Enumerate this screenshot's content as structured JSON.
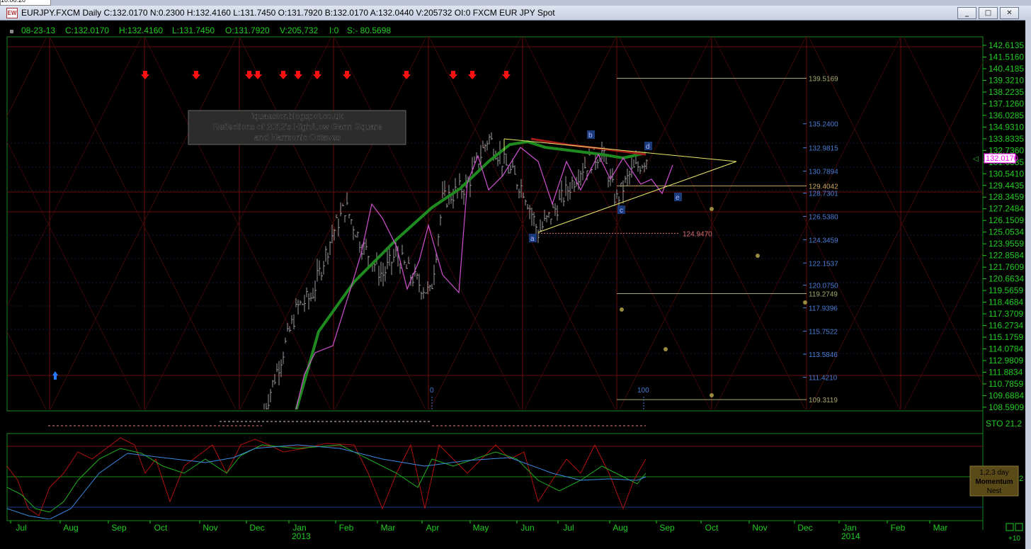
{
  "window": {
    "title": "EURJPY.FXCM Daily C:132.0170 N:0.2300 H:132.4160 L:131.7450 O:131.7920 B:132.0170 A:132.0440 V:205732 OI:0 FXCM EUR JPY Spot",
    "clock": "10:00:20",
    "icon_label": "EW",
    "buttons": {
      "minimize": "_",
      "maximize": "□",
      "close": "✕"
    }
  },
  "info_bar": {
    "date": "08-23-13",
    "close": "C:132.0170",
    "high": "H:132.4160",
    "low": "L:131.7450",
    "open": "O:131.7920",
    "volume": "V:205,732",
    "oi": "I:0",
    "s": "S:- 80.5698"
  },
  "annotation": {
    "line1": "iquaestor.blogspot.co.uk",
    "line2": "Reflections of 2012's High/Low Gann Square",
    "line3": "and Harmonic Octaves"
  },
  "price_axis": {
    "ticks": [
      "142.6135",
      "141.5160",
      "140.4185",
      "139.3210",
      "138.2235",
      "137.1260",
      "136.0285",
      "134.9310",
      "133.8335",
      "132.7360",
      "131.6385",
      "130.5410",
      "129.4435",
      "128.3459",
      "127.2484",
      "126.1509",
      "125.0534",
      "123.9559",
      "122.8584",
      "121.7609",
      "120.6634",
      "119.5659",
      "118.4684",
      "117.3709",
      "116.2734",
      "115.1759",
      "114.0784",
      "112.9809",
      "111.8834",
      "110.7859",
      "109.6884",
      "108.5909"
    ],
    "current": "132.0170"
  },
  "level_labels": [
    {
      "text": "139.5169",
      "price": 139.5169,
      "color": "#a8a870"
    },
    {
      "text": "135.2400",
      "price": 135.24,
      "color": "#4a7cd6"
    },
    {
      "text": "132.9815",
      "price": 132.9815,
      "color": "#4a7cd6"
    },
    {
      "text": "130.7894",
      "price": 130.7894,
      "color": "#4a7cd6"
    },
    {
      "text": "129.4042",
      "price": 129.4042,
      "color": "#c8a860"
    },
    {
      "text": "128.7301",
      "price": 128.7301,
      "color": "#4a7cd6"
    },
    {
      "text": "126.5380",
      "price": 126.538,
      "color": "#4a7cd6"
    },
    {
      "text": "124.9470",
      "price": 124.947,
      "color": "#e07070"
    },
    {
      "text": "124.3459",
      "price": 124.3459,
      "color": "#4a7cd6"
    },
    {
      "text": "122.1537",
      "price": 122.1537,
      "color": "#4a7cd6"
    },
    {
      "text": "120.0750",
      "price": 120.075,
      "color": "#4a7cd6"
    },
    {
      "text": "119.2749",
      "price": 119.2749,
      "color": "#a8a870"
    },
    {
      "text": "117.9396",
      "price": 117.9396,
      "color": "#4a7cd6"
    },
    {
      "text": "115.7522",
      "price": 115.7522,
      "color": "#4a7cd6"
    },
    {
      "text": "113.5846",
      "price": 113.5846,
      "color": "#4a7cd6"
    },
    {
      "text": "111.4210",
      "price": 111.421,
      "color": "#4a7cd6"
    },
    {
      "text": "109.3119",
      "price": 109.3119,
      "color": "#a8a870"
    }
  ],
  "wave_labels": [
    "a",
    "b",
    "c",
    "d",
    "e"
  ],
  "cycle_labels": [
    "0",
    "100"
  ],
  "stoch_panel": {
    "label": "STO  21,2",
    "scale": "2",
    "box": {
      "line1": "1,2,3 day",
      "line2": "Momentum",
      "line3": "Nest"
    }
  },
  "time_axis": {
    "months": [
      "Jul",
      "Aug",
      "Sep",
      "Oct",
      "Nov",
      "Dec",
      "Jan",
      "Feb",
      "Mar",
      "Apr",
      "May",
      "Jun",
      "Jul",
      "Aug",
      "Sep",
      "Oct",
      "Nov",
      "Dec",
      "Jan",
      "Feb",
      "Mar"
    ],
    "year_2013": "2013",
    "year_2014": "2014",
    "zoom_label": "+10"
  },
  "colors": {
    "axis_text": "#22cc22",
    "grid_red": "#7a1010",
    "current_price_box": "#ff00ff",
    "ma_green": "#1f8a1f",
    "oscillator_pink": "#d050d0",
    "stoch_red": "#b01010",
    "stoch_green": "#20b020",
    "stoch_blue": "#3a8ae0"
  }
}
